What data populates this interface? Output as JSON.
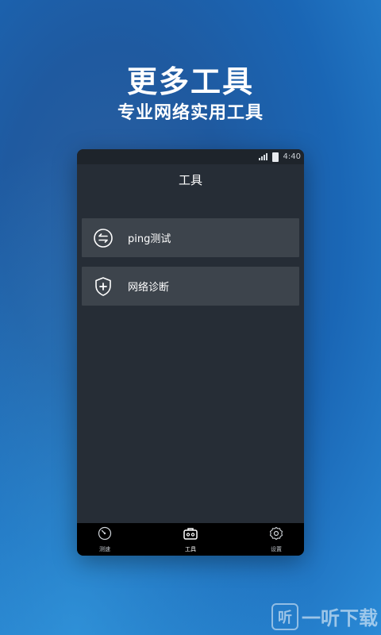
{
  "promo": {
    "headline": "更多工具",
    "subline": "专业网络实用工具"
  },
  "statusbar": {
    "time": "4:40",
    "signal_icon": "signal-icon",
    "battery_icon": "battery-icon"
  },
  "app": {
    "title": "工具",
    "tools": [
      {
        "label": "ping测试",
        "icon": "ping-swap-icon"
      },
      {
        "label": "网络诊断",
        "icon": "shield-plus-icon"
      }
    ],
    "tabs": [
      {
        "label": "测速",
        "icon": "speedometer-icon"
      },
      {
        "label": "工具",
        "icon": "toolbox-icon"
      },
      {
        "label": "设置",
        "icon": "gear-icon"
      }
    ]
  },
  "watermark": {
    "logo_glyph": "听",
    "text": "一听下载"
  },
  "colors": {
    "phone_bg": "#262d36",
    "item_bg": "#3d444c",
    "tabbar_bg": "#000000",
    "page_bg": "#1f5fa6"
  }
}
